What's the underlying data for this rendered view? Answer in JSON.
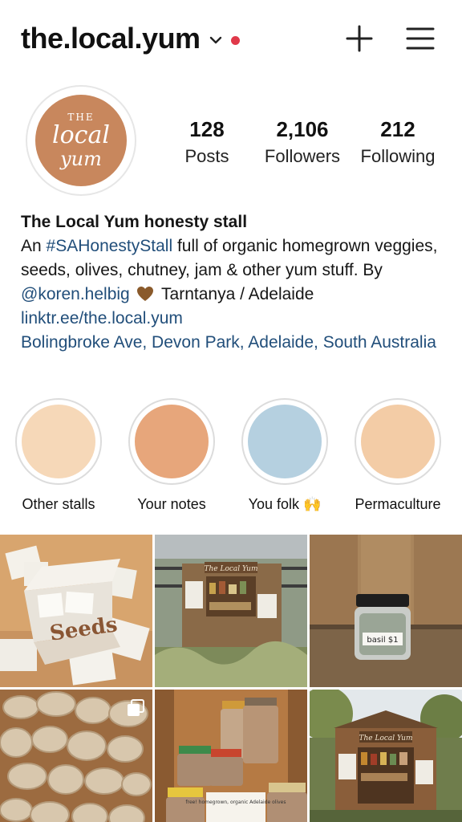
{
  "header": {
    "username": "the.local.yum",
    "notification_color": "#e0394a"
  },
  "profile": {
    "avatar": {
      "line1": "THE",
      "line2": "local",
      "line3": "yum",
      "bg_color": "#c8875d"
    },
    "stats": [
      {
        "value": "128",
        "label": "Posts"
      },
      {
        "value": "2,106",
        "label": "Followers"
      },
      {
        "value": "212",
        "label": "Following"
      }
    ]
  },
  "bio": {
    "name": "The Local Yum honesty stall",
    "line1_pre": "An ",
    "hashtag": "#SAHonestyStall",
    "line1_post": " full of organic homegrown veggies, seeds, olives, chutney, jam & other yum stuff. By ",
    "mention": "@koren.helbig",
    "post_mention": " Tarntanya / Adelaide",
    "website": "linktr.ee/the.local.yum",
    "address": "Bolingbroke Ave, Devon Park, Adelaide, South Australia"
  },
  "highlights": [
    {
      "label": "Other stalls",
      "color": "#f6d8b8"
    },
    {
      "label": "Your notes",
      "color": "#e7a67b"
    },
    {
      "label": "You folk 🙌",
      "color": "#b5d0e0"
    },
    {
      "label": "Permaculture",
      "color": "#f3cca6"
    }
  ],
  "posts": [
    {
      "text": "Seeds",
      "kind": "seed-box"
    },
    {
      "text": "The Local Yum",
      "kind": "stall-front"
    },
    {
      "text": "basil $1",
      "kind": "jar"
    },
    {
      "text": "",
      "kind": "tubers",
      "multi": true
    },
    {
      "text": "free! homegrown, organic Adelaide olives",
      "kind": "olive-jars"
    },
    {
      "text": "The Local Yum",
      "kind": "stall-garden"
    }
  ]
}
